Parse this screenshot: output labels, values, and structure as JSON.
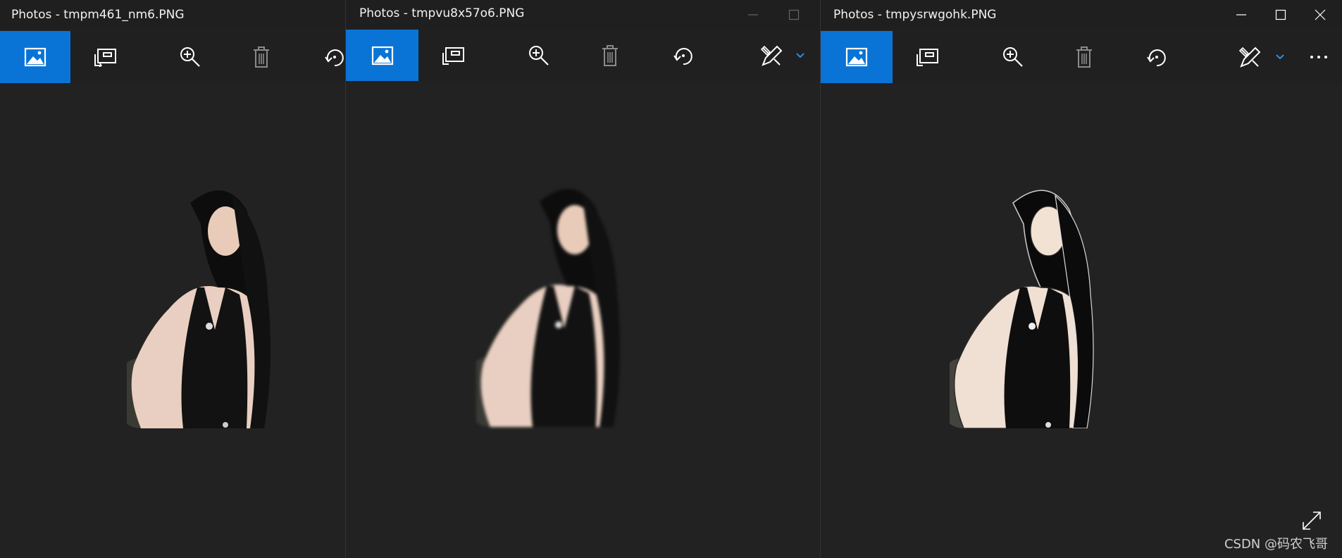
{
  "windows": [
    {
      "title": "Photos - tmpm461_nm6.PNG",
      "toolbar": [
        "see-all-photos-icon",
        "add-to-album-icon",
        "zoom-icon",
        "delete-icon",
        "rotate-icon"
      ]
    },
    {
      "title": "Photos - tmpvu8x57o6.PNG",
      "toolbar": [
        "see-all-photos-icon",
        "add-to-album-icon",
        "zoom-icon",
        "delete-icon",
        "rotate-icon",
        "edit-icon",
        "chevron-down-icon"
      ],
      "window_controls": [
        "minimize-icon",
        "maximize-icon"
      ]
    },
    {
      "title": "Photos - tmpysrwgohk.PNG",
      "toolbar": [
        "see-all-photos-icon",
        "add-to-album-icon",
        "zoom-icon",
        "delete-icon",
        "rotate-icon",
        "edit-icon",
        "chevron-down-icon",
        "more-options-icon"
      ],
      "window_controls": [
        "minimize-icon",
        "maximize-icon",
        "close-icon"
      ]
    }
  ],
  "watermark": "CSDN @码农飞哥",
  "colors": {
    "accent": "#0a74d6",
    "background": "#222222",
    "titlebar": "#1f1f1f"
  }
}
